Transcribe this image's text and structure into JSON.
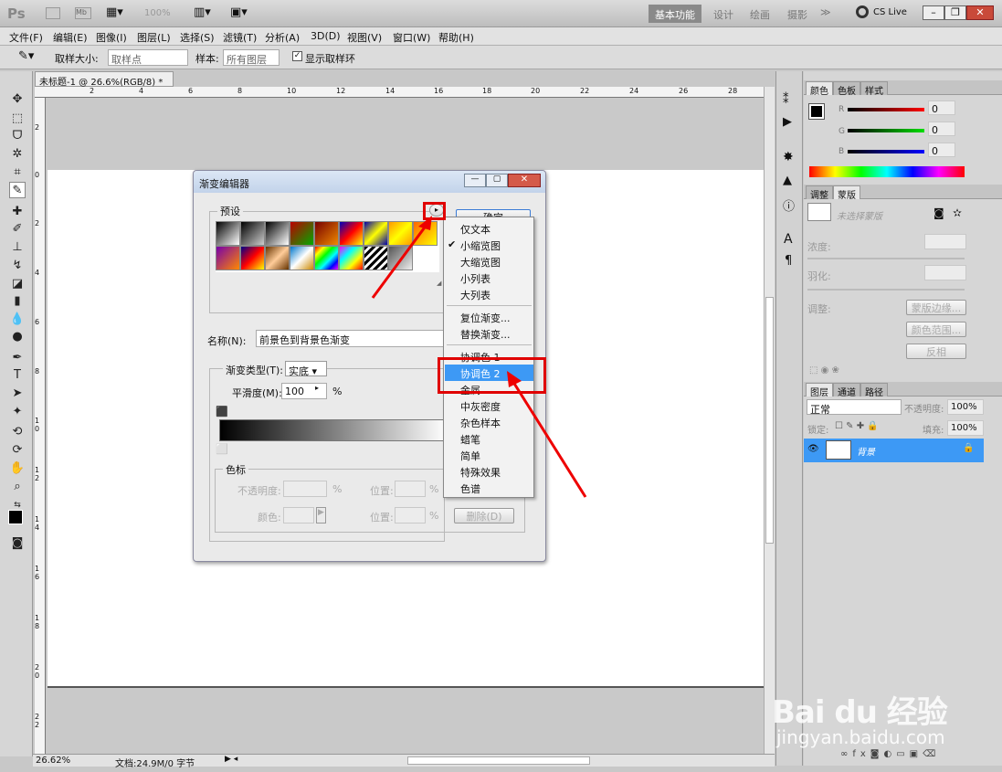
{
  "app": {
    "logo": "Ps",
    "zoom": "100%",
    "workspaces": [
      "基本功能",
      "设计",
      "绘画",
      "摄影"
    ],
    "more": "≫",
    "cslive": "CS Live"
  },
  "menus": [
    "文件(F)",
    "编辑(E)",
    "图像(I)",
    "图层(L)",
    "选择(S)",
    "滤镜(T)",
    "分析(A)",
    "3D(D)",
    "视图(V)",
    "窗口(W)",
    "帮助(H)"
  ],
  "options": {
    "sample_size_label": "取样大小:",
    "sample_size_value": "取样点",
    "sample_label": "样本:",
    "sample_value": "所有图层",
    "show_ring": "显示取样环"
  },
  "document": {
    "tab": "未标题-1 @ 26.6%(RGB/8) *",
    "ruler_h": [
      "2",
      "4",
      "6",
      "8",
      "10",
      "12",
      "14",
      "16",
      "18",
      "20",
      "22",
      "24",
      "26",
      "28"
    ],
    "ruler_v": [
      "2",
      "0",
      "2",
      "4",
      "6",
      "8",
      "1 0",
      "1 2",
      "1 4",
      "1 6",
      "1 8",
      "2 0",
      "2 2",
      "2 4"
    ]
  },
  "status": {
    "zoom": "26.62%",
    "doc": "文档:24.9M/0 字节"
  },
  "color_panel": {
    "tabs": [
      "颜色",
      "色板",
      "样式"
    ],
    "r_label": "R",
    "g_label": "G",
    "b_label": "B",
    "r": "0",
    "g": "0",
    "b": "0"
  },
  "adjust_panel": {
    "tabs": [
      "调整",
      "蒙版"
    ],
    "mask_label": "未选择蒙版",
    "density": "浓度:",
    "feather": "羽化:",
    "refine": "调整:",
    "btn_edge": "蒙版边缘...",
    "btn_range": "颜色范围...",
    "btn_invert": "反相"
  },
  "layers_panel": {
    "tabs": [
      "图层",
      "通道",
      "路径"
    ],
    "blend": "正常",
    "opacity_label": "不透明度:",
    "opacity": "100%",
    "lock_label": "锁定:",
    "fill_label": "填充:",
    "fill": "100%",
    "layer_name": "背景"
  },
  "dialog": {
    "title": "渐变编辑器",
    "presets_label": "预设",
    "ok": "确定",
    "name_label": "名称(N):",
    "name_value": "前景色到背景色渐变",
    "type_label": "渐变类型(T):",
    "type_value": "实底",
    "smooth_label": "平滑度(M):",
    "smooth_value": "100",
    "percent": "%",
    "stops_label": "色标",
    "opacity_label": "不透明度:",
    "color_label": "颜色:",
    "position_label": "位置:",
    "delete": "删除(D)"
  },
  "context_menu": {
    "items": [
      "仅文本",
      "小缩览图",
      "大缩览图",
      "小列表",
      "大列表",
      "复位渐变...",
      "替换渐变...",
      "协调色 1",
      "协调色 2",
      "金属",
      "中灰密度",
      "杂色样本",
      "蜡笔",
      "简单",
      "特殊效果",
      "色谱"
    ],
    "checked": "小缩览图",
    "highlighted": "协调色 2"
  },
  "watermark": {
    "brand": "Bai du 经验",
    "url": "jingyan.baidu.com"
  }
}
